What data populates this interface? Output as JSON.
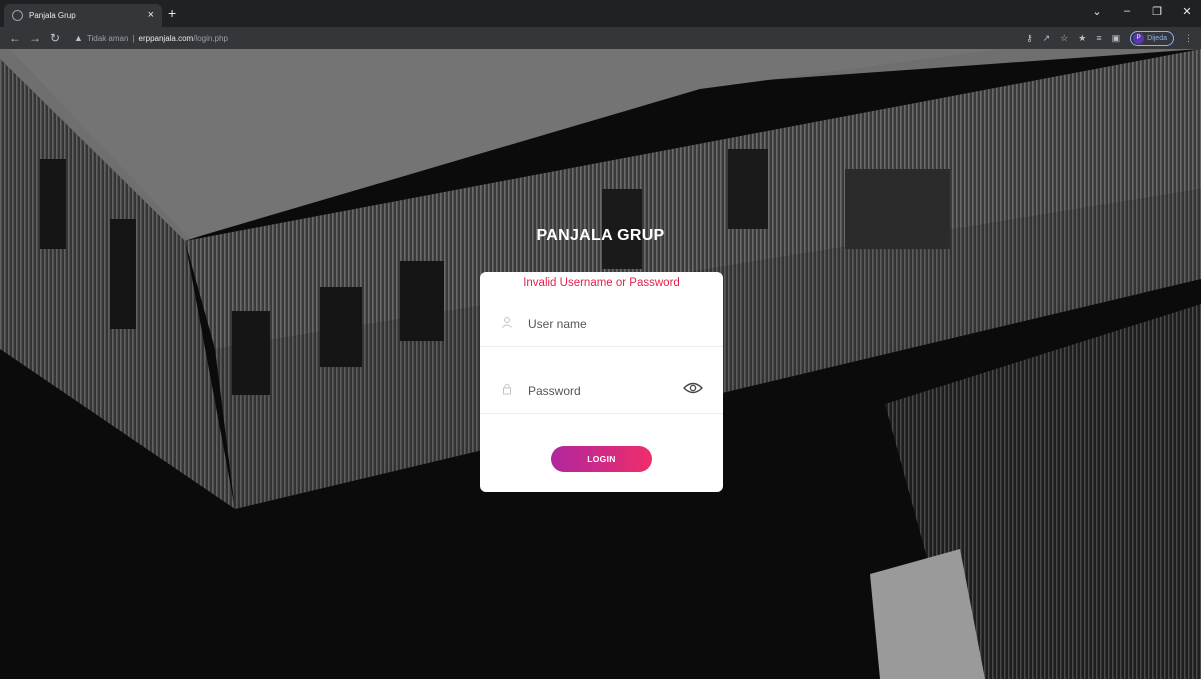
{
  "browser": {
    "tab_title": "Panjala Grup",
    "tab_close": "×",
    "new_tab": "+",
    "window_controls": [
      "⌄",
      "–",
      "❐",
      "✕"
    ],
    "address": {
      "insecure_label": "Tidak aman",
      "separator": "|",
      "host": "erppanjala.com",
      "path": "/login.php"
    },
    "profile_initial": "P",
    "profile_label": "Dijeda"
  },
  "page": {
    "brand": "PANJALA GRUP",
    "error_message": "Invalid Username or Password",
    "username_placeholder": "User name",
    "password_placeholder": "Password",
    "login_label": "LOGIN"
  },
  "colors": {
    "error": "#e4214a",
    "button_gradient_start": "#b0279e",
    "button_gradient_end": "#ef2d6b"
  }
}
